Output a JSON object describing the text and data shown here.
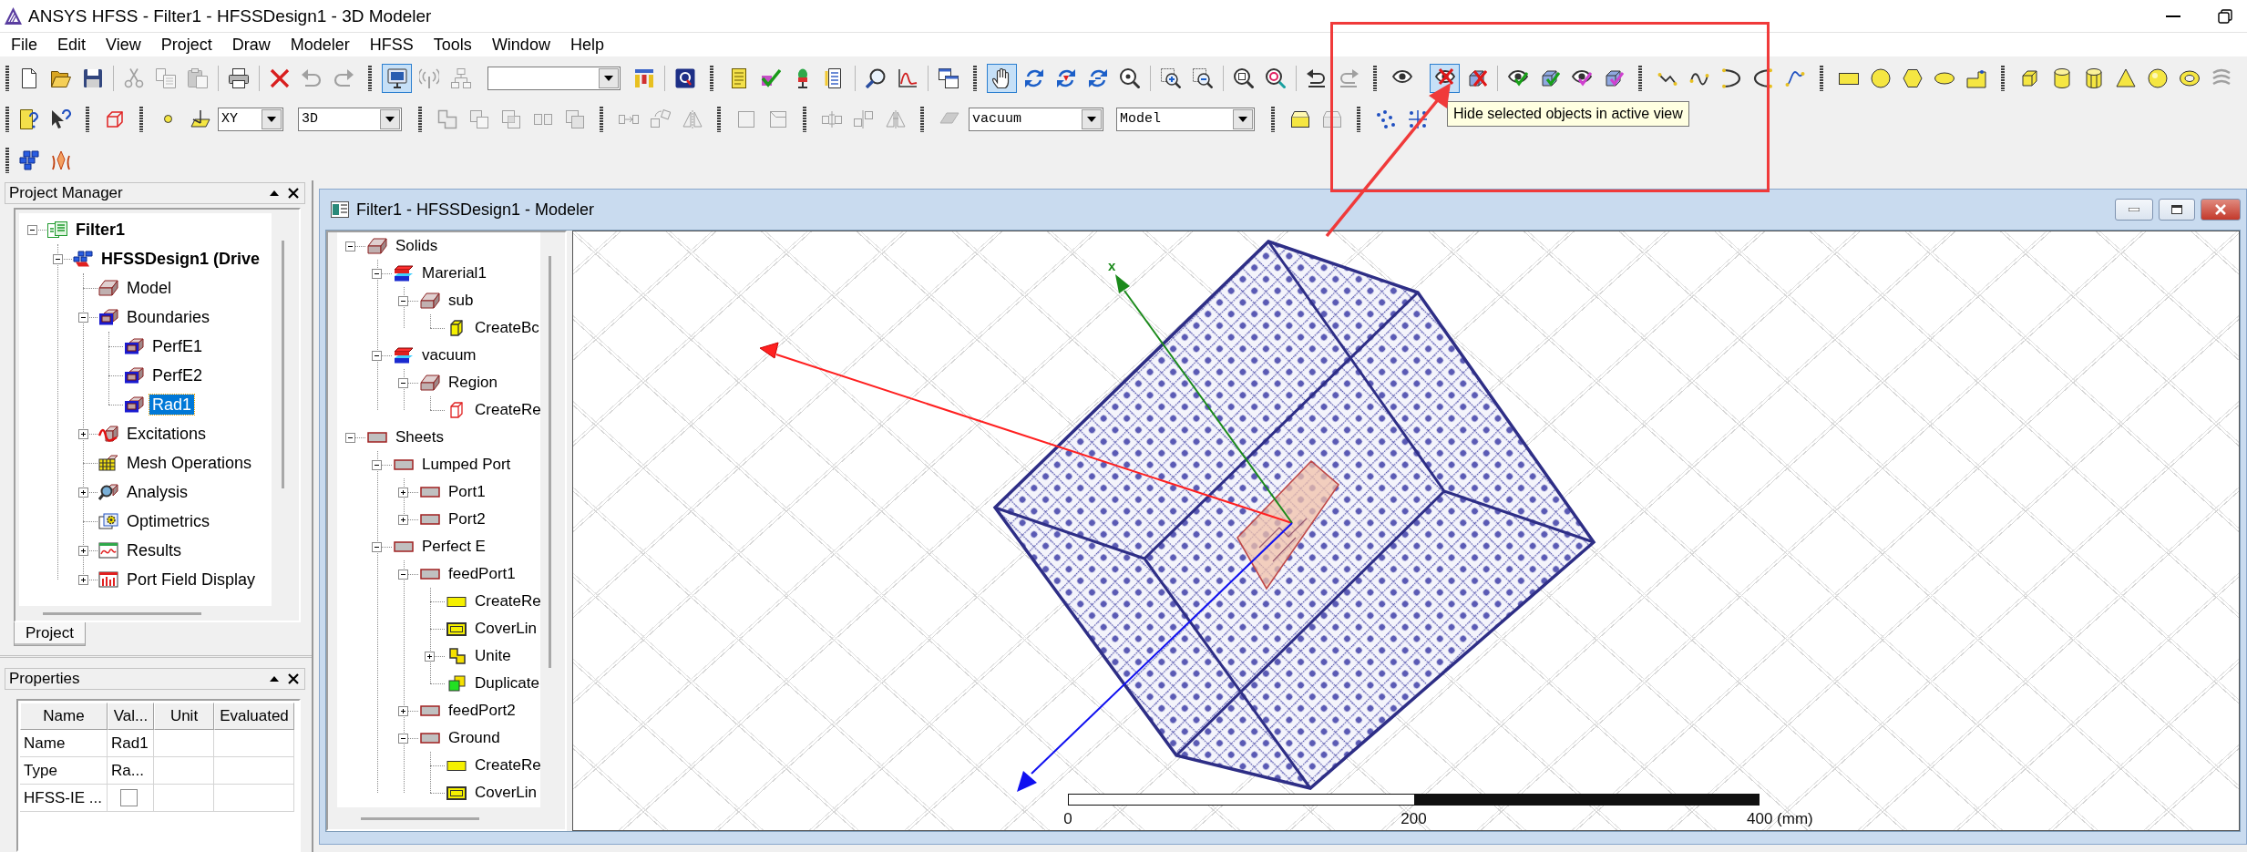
{
  "window": {
    "title": "ANSYS HFSS - Filter1 - HFSSDesign1 - 3D Modeler"
  },
  "menu": [
    "File",
    "Edit",
    "View",
    "Project",
    "Draw",
    "Modeler",
    "HFSS",
    "Tools",
    "Window",
    "Help"
  ],
  "toolbars": [
    {
      "items": [
        {
          "kind": "grip"
        },
        {
          "kind": "newfile",
          "pressed": false,
          "disabled": false
        },
        {
          "kind": "open",
          "pressed": false,
          "disabled": false
        },
        {
          "kind": "save",
          "pressed": false,
          "disabled": false
        },
        {
          "kind": "sep"
        },
        {
          "kind": "cut",
          "pressed": false,
          "disabled": true
        },
        {
          "kind": "copy",
          "pressed": false,
          "disabled": true
        },
        {
          "kind": "paste",
          "pressed": false,
          "disabled": true
        },
        {
          "kind": "sep"
        },
        {
          "kind": "print",
          "pressed": false,
          "disabled": false
        },
        {
          "kind": "sep"
        },
        {
          "kind": "delete",
          "pressed": false,
          "disabled": false
        },
        {
          "kind": "undo",
          "pressed": false,
          "disabled": true
        },
        {
          "kind": "redo",
          "pressed": false,
          "disabled": true
        },
        {
          "kind": "grip"
        },
        {
          "kind": "select",
          "pressed": true,
          "disabled": false
        },
        {
          "kind": "antenna",
          "pressed": false,
          "disabled": true
        },
        {
          "kind": "network",
          "pressed": false,
          "disabled": true
        },
        {
          "kind": "combo"
        },
        {
          "kind": "hierarchy",
          "pressed": false,
          "disabled": false
        },
        {
          "kind": "sep"
        },
        {
          "kind": "qbox",
          "pressed": false,
          "disabled": false
        },
        {
          "kind": "grip"
        },
        {
          "kind": "notes",
          "pressed": false,
          "disabled": false
        },
        {
          "kind": "validate",
          "pressed": false,
          "disabled": false
        },
        {
          "kind": "mic",
          "pressed": false,
          "disabled": false
        },
        {
          "kind": "doclist",
          "pressed": false,
          "disabled": false
        },
        {
          "kind": "sep"
        },
        {
          "kind": "probe",
          "pressed": false,
          "disabled": false
        },
        {
          "kind": "plot",
          "pressed": false,
          "disabled": false
        },
        {
          "kind": "sep"
        },
        {
          "kind": "windows",
          "pressed": false,
          "disabled": false
        },
        {
          "kind": "grip"
        },
        {
          "kind": "pan",
          "pressed": true,
          "disabled": false
        },
        {
          "kind": "rotate",
          "pressed": false,
          "disabled": false
        },
        {
          "kind": "spin",
          "pressed": false,
          "disabled": false
        },
        {
          "kind": "orbit",
          "pressed": false,
          "disabled": false
        },
        {
          "kind": "zoominfo",
          "pressed": false,
          "disabled": false
        },
        {
          "kind": "sep"
        },
        {
          "kind": "zoomin",
          "pressed": false,
          "disabled": false
        },
        {
          "kind": "zoomout",
          "pressed": false,
          "disabled": false
        },
        {
          "kind": "sep"
        },
        {
          "kind": "fitall",
          "pressed": false,
          "disabled": false
        },
        {
          "kind": "fitsel",
          "pressed": false,
          "disabled": false
        },
        {
          "kind": "sep"
        },
        {
          "kind": "viewundo",
          "pressed": false,
          "disabled": false
        },
        {
          "kind": "viewredo",
          "pressed": false,
          "disabled": true
        },
        {
          "kind": "grip"
        },
        {
          "kind": "show",
          "pressed": false,
          "disabled": false
        },
        {
          "kind": "hide",
          "pressed": true,
          "disabled": false
        },
        {
          "kind": "hidebox",
          "pressed": false,
          "disabled": false
        },
        {
          "kind": "sep"
        },
        {
          "kind": "showall",
          "pressed": false,
          "disabled": false
        },
        {
          "kind": "showallbox",
          "pressed": false,
          "disabled": false
        },
        {
          "kind": "showactive",
          "pressed": false,
          "disabled": false
        },
        {
          "kind": "showactivebox",
          "pressed": false,
          "disabled": false
        },
        {
          "kind": "grip"
        },
        {
          "kind": "line",
          "pressed": false,
          "disabled": false
        },
        {
          "kind": "spline",
          "pressed": false,
          "disabled": false
        },
        {
          "kind": "arc",
          "pressed": false,
          "disabled": false
        },
        {
          "kind": "arcb",
          "pressed": false,
          "disabled": false
        },
        {
          "kind": "equation",
          "pressed": false,
          "disabled": false
        },
        {
          "kind": "grip"
        },
        {
          "kind": "rect",
          "pressed": false,
          "disabled": false
        },
        {
          "kind": "circle",
          "pressed": false,
          "disabled": false
        },
        {
          "kind": "polygon",
          "pressed": false,
          "disabled": false
        },
        {
          "kind": "ellipse",
          "pressed": false,
          "disabled": false
        },
        {
          "kind": "region",
          "pressed": false,
          "disabled": false
        },
        {
          "kind": "grip"
        },
        {
          "kind": "box",
          "pressed": false,
          "disabled": false
        },
        {
          "kind": "cylinder",
          "pressed": false,
          "disabled": false
        },
        {
          "kind": "prism",
          "pressed": false,
          "disabled": false
        },
        {
          "kind": "cone",
          "pressed": false,
          "disabled": false
        },
        {
          "kind": "sphere",
          "pressed": false,
          "disabled": false
        },
        {
          "kind": "torus",
          "pressed": false,
          "disabled": false
        },
        {
          "kind": "helix",
          "pressed": false,
          "disabled": true
        }
      ]
    },
    {
      "items": [
        {
          "kind": "grip"
        },
        {
          "kind": "helpdoc",
          "pressed": false,
          "disabled": false
        },
        {
          "kind": "whatsthis",
          "pressed": false,
          "disabled": false
        },
        {
          "kind": "grip"
        },
        {
          "kind": "wirecube",
          "pressed": false,
          "disabled": false
        },
        {
          "kind": "grip"
        },
        {
          "kind": "point",
          "pressed": false,
          "disabled": false
        },
        {
          "kind": "plane",
          "pressed": false,
          "disabled": false
        },
        {
          "kind": "combo",
          "value": "XY"
        },
        {
          "kind": "combo",
          "value": "3D"
        },
        {
          "kind": "grip"
        },
        {
          "kind": "unite",
          "pressed": false,
          "disabled": true
        },
        {
          "kind": "subtract",
          "pressed": false,
          "disabled": true
        },
        {
          "kind": "intersect",
          "pressed": false,
          "disabled": true
        },
        {
          "kind": "split",
          "pressed": false,
          "disabled": true
        },
        {
          "kind": "imprint",
          "pressed": false,
          "disabled": true
        },
        {
          "kind": "grip"
        },
        {
          "kind": "move",
          "pressed": false,
          "disabled": true
        },
        {
          "kind": "turn",
          "pressed": false,
          "disabled": true
        },
        {
          "kind": "mirror",
          "pressed": false,
          "disabled": true
        },
        {
          "kind": "grip"
        },
        {
          "kind": "sweep",
          "pressed": false,
          "disabled": true
        },
        {
          "kind": "thicken",
          "pressed": false,
          "disabled": true
        },
        {
          "kind": "grip"
        },
        {
          "kind": "dupline",
          "pressed": false,
          "disabled": true
        },
        {
          "kind": "duparound",
          "pressed": false,
          "disabled": true
        },
        {
          "kind": "dupmirror",
          "pressed": false,
          "disabled": true
        },
        {
          "kind": "grip"
        },
        {
          "kind": "surface",
          "pressed": false,
          "disabled": true
        },
        {
          "kind": "combo",
          "value": "vacuum"
        },
        {
          "kind": "combo",
          "value": "Model"
        },
        {
          "kind": "grip"
        },
        {
          "kind": "tray",
          "pressed": false,
          "disabled": false
        },
        {
          "kind": "traygrey",
          "pressed": false,
          "disabled": true
        },
        {
          "kind": "grip"
        },
        {
          "kind": "points",
          "pressed": false,
          "disabled": false
        },
        {
          "kind": "gridpoints",
          "pressed": false,
          "disabled": false
        }
      ]
    },
    {
      "items": [
        {
          "kind": "grip"
        },
        {
          "kind": "cubes",
          "pressed": false,
          "disabled": false
        },
        {
          "kind": "antennaarray",
          "pressed": false,
          "disabled": false
        }
      ]
    }
  ],
  "tooltip": {
    "text": "Hide selected objects in active view"
  },
  "project_manager": {
    "title": "Project Manager",
    "tree": [
      {
        "label": "Filter1",
        "kind": "project",
        "expanded": true,
        "selected": false,
        "children": [
          {
            "label": "HFSSDesign1 (Drive",
            "kind": "design",
            "expanded": true,
            "selected": false,
            "children": [
              {
                "label": "Model",
                "kind": "model",
                "selected": false
              },
              {
                "label": "Boundaries",
                "kind": "boundary",
                "expanded": true,
                "selected": false,
                "children": [
                  {
                    "label": "PerfE1",
                    "kind": "boundary",
                    "selected": false
                  },
                  {
                    "label": "PerfE2",
                    "kind": "boundary",
                    "selected": false
                  },
                  {
                    "label": "Rad1",
                    "kind": "boundary",
                    "selected": true
                  }
                ]
              },
              {
                "label": "Excitations",
                "kind": "excitation",
                "expanded": false,
                "selected": false
              },
              {
                "label": "Mesh Operations",
                "kind": "mesh",
                "selected": false
              },
              {
                "label": "Analysis",
                "kind": "analysis",
                "expanded": false,
                "selected": false
              },
              {
                "label": "Optimetrics",
                "kind": "optimetrics",
                "selected": false
              },
              {
                "label": "Results",
                "kind": "results",
                "expanded": false,
                "selected": false
              },
              {
                "label": "Port Field Display",
                "kind": "fields",
                "expanded": false,
                "selected": false
              }
            ]
          }
        ]
      }
    ],
    "tabs": [
      {
        "label": "Project",
        "selected": true
      }
    ]
  },
  "properties": {
    "title": "Properties",
    "columns": [
      "Name",
      "Val...",
      "Unit",
      "Evaluated"
    ],
    "rows": [
      {
        "kind": "text",
        "name": "Name",
        "value": "Rad1"
      },
      {
        "kind": "text",
        "name": "Type",
        "value": "Ra..."
      },
      {
        "kind": "checkbox",
        "name": "HFSS-IE ...",
        "checked": false
      }
    ]
  },
  "modeler": {
    "title": "Filter1 - HFSSDesign1 - Modeler",
    "tree": [
      {
        "label": "Solids",
        "kind": "solid",
        "expanded": true,
        "selected": false,
        "children": [
          {
            "label": "Marerial1",
            "kind": "material",
            "expanded": true,
            "selected": false,
            "children": [
              {
                "label": "sub",
                "kind": "solid",
                "expanded": true,
                "selected": false,
                "children": [
                  {
                    "label": "CreateBc",
                    "kind": "box",
                    "selected": false
                  }
                ]
              }
            ]
          },
          {
            "label": "vacuum",
            "kind": "material",
            "expanded": true,
            "selected": false,
            "children": [
              {
                "label": "Region",
                "kind": "solid",
                "expanded": true,
                "selected": false,
                "children": [
                  {
                    "label": "CreateRe",
                    "kind": "region",
                    "selected": false
                  }
                ]
              }
            ]
          }
        ]
      },
      {
        "label": "Sheets",
        "kind": "sheet",
        "expanded": true,
        "selected": false,
        "children": [
          {
            "label": "Lumped Port",
            "kind": "sheet",
            "expanded": true,
            "selected": false,
            "children": [
              {
                "label": "Port1",
                "kind": "sheet",
                "expanded": false,
                "selected": false
              },
              {
                "label": "Port2",
                "kind": "sheet",
                "expanded": false,
                "selected": false
              }
            ]
          },
          {
            "label": "Perfect E",
            "kind": "sheet",
            "expanded": true,
            "selected": false,
            "children": [
              {
                "label": "feedPort1",
                "kind": "sheet",
                "expanded": true,
                "selected": false,
                "children": [
                  {
                    "label": "CreateRe",
                    "kind": "rect",
                    "selected": false
                  },
                  {
                    "label": "CoverLin",
                    "kind": "cover",
                    "selected": false
                  },
                  {
                    "label": "Unite",
                    "kind": "unite",
                    "expanded": false,
                    "selected": false
                  },
                  {
                    "label": "Duplicate",
                    "kind": "duplicate",
                    "selected": false
                  }
                ]
              },
              {
                "label": "feedPort2",
                "kind": "sheet",
                "expanded": false,
                "selected": false
              },
              {
                "label": "Ground",
                "kind": "sheet",
                "expanded": true,
                "selected": false,
                "children": [
                  {
                    "label": "CreateRe",
                    "kind": "rect",
                    "selected": false
                  },
                  {
                    "label": "CoverLin",
                    "kind": "cover",
                    "selected": false
                  }
                ]
              }
            ]
          }
        ]
      }
    ],
    "axis_labels": [
      "x"
    ],
    "scale_bar": {
      "labels": [
        "0",
        "200",
        "400 (mm)"
      ]
    }
  }
}
